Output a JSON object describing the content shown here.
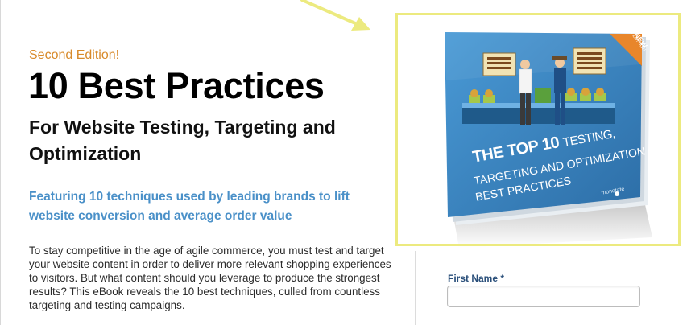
{
  "header": {
    "edition": "Second Edition!",
    "title": "10 Best Practices",
    "subtitle": "For Website Testing, Targeting and Optimization"
  },
  "feature_text": "Featuring 10 techniques used by leading brands to lift website conversion and average order value",
  "body_text": "To stay competitive in the age of agile commerce, you must test and target your website content in order to deliver more relevant shopping experiences to visitors. But what content should you leverage to produce the strongest results? This eBook reveals the 10 best techniques, culled from countless targeting and testing campaigns.",
  "form": {
    "first_name_label": "First Name *",
    "first_name_value": ""
  },
  "ebook": {
    "title_line1_bold": "THE TOP 10",
    "title_line1_rest": "TESTING,",
    "title_line2": "TARGETING AND OPTIMIZATION",
    "title_line3": "BEST PRACTICES",
    "badge_new": "NEW",
    "badge_edition": "2ND EDITION",
    "brand": "monetate",
    "sign_left": "URBAN CUSTOMERS BUILT IN RESTAURANT FINDER",
    "sign_right": "RETAIL ENTHUSIASTS REQUEST RETAIL SERVICE"
  },
  "colors": {
    "edition": "#d88a2a",
    "feature": "#4a90c8",
    "label": "#2a4f7a",
    "highlight": "#ecea7f",
    "cover_blue": "#3a86c4"
  }
}
